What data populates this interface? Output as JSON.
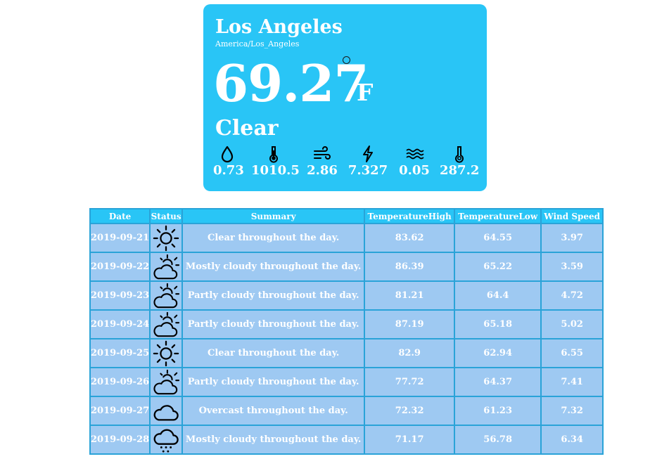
{
  "current": {
    "city": "Los Angeles",
    "timezone": "America/Los_Angeles",
    "temperature": "69.27",
    "unit": "F",
    "condition": "Clear",
    "stats": [
      {
        "icon": "humidity-icon",
        "value": "0.73"
      },
      {
        "icon": "pressure-thermometer-icon",
        "value": "1010.5"
      },
      {
        "icon": "wind-icon",
        "value": "2.86"
      },
      {
        "icon": "lightning-icon",
        "value": "7.327"
      },
      {
        "icon": "waves-icon",
        "value": "0.05"
      },
      {
        "icon": "thermometer-icon",
        "value": "287.2"
      }
    ]
  },
  "table": {
    "headers": [
      "Date",
      "Status",
      "Summary",
      "TemperatureHigh",
      "TemperatureLow",
      "Wind Speed"
    ],
    "rows": [
      {
        "date": "2019-09-21",
        "status_icon": "clear-day-icon",
        "summary": "Clear throughout the day.",
        "high": "83.62",
        "low": "64.55",
        "wind": "3.97"
      },
      {
        "date": "2019-09-22",
        "status_icon": "partly-cloudy-day-icon",
        "summary": "Mostly cloudy throughout the day.",
        "high": "86.39",
        "low": "65.22",
        "wind": "3.59"
      },
      {
        "date": "2019-09-23",
        "status_icon": "partly-cloudy-day-icon",
        "summary": "Partly cloudy throughout the day.",
        "high": "81.21",
        "low": "64.4",
        "wind": "4.72"
      },
      {
        "date": "2019-09-24",
        "status_icon": "partly-cloudy-day-icon",
        "summary": "Partly cloudy throughout the day.",
        "high": "87.19",
        "low": "65.18",
        "wind": "5.02"
      },
      {
        "date": "2019-09-25",
        "status_icon": "clear-day-icon",
        "summary": "Clear throughout the day.",
        "high": "82.9",
        "low": "62.94",
        "wind": "6.55"
      },
      {
        "date": "2019-09-26",
        "status_icon": "partly-cloudy-day-icon",
        "summary": "Partly cloudy throughout the day.",
        "high": "77.72",
        "low": "64.37",
        "wind": "7.41"
      },
      {
        "date": "2019-09-27",
        "status_icon": "cloudy-icon",
        "summary": "Overcast throughout the day.",
        "high": "72.32",
        "low": "61.23",
        "wind": "7.32"
      },
      {
        "date": "2019-09-28",
        "status_icon": "rain-icon",
        "summary": "Mostly cloudy throughout the day.",
        "high": "71.17",
        "low": "56.78",
        "wind": "6.34"
      }
    ]
  },
  "colors": {
    "card_background": "#29c5f6",
    "table_header": "#29c5f6",
    "table_cell": "#9ec9f2",
    "table_border": "#2aa3d8",
    "text": "#ffffff"
  }
}
